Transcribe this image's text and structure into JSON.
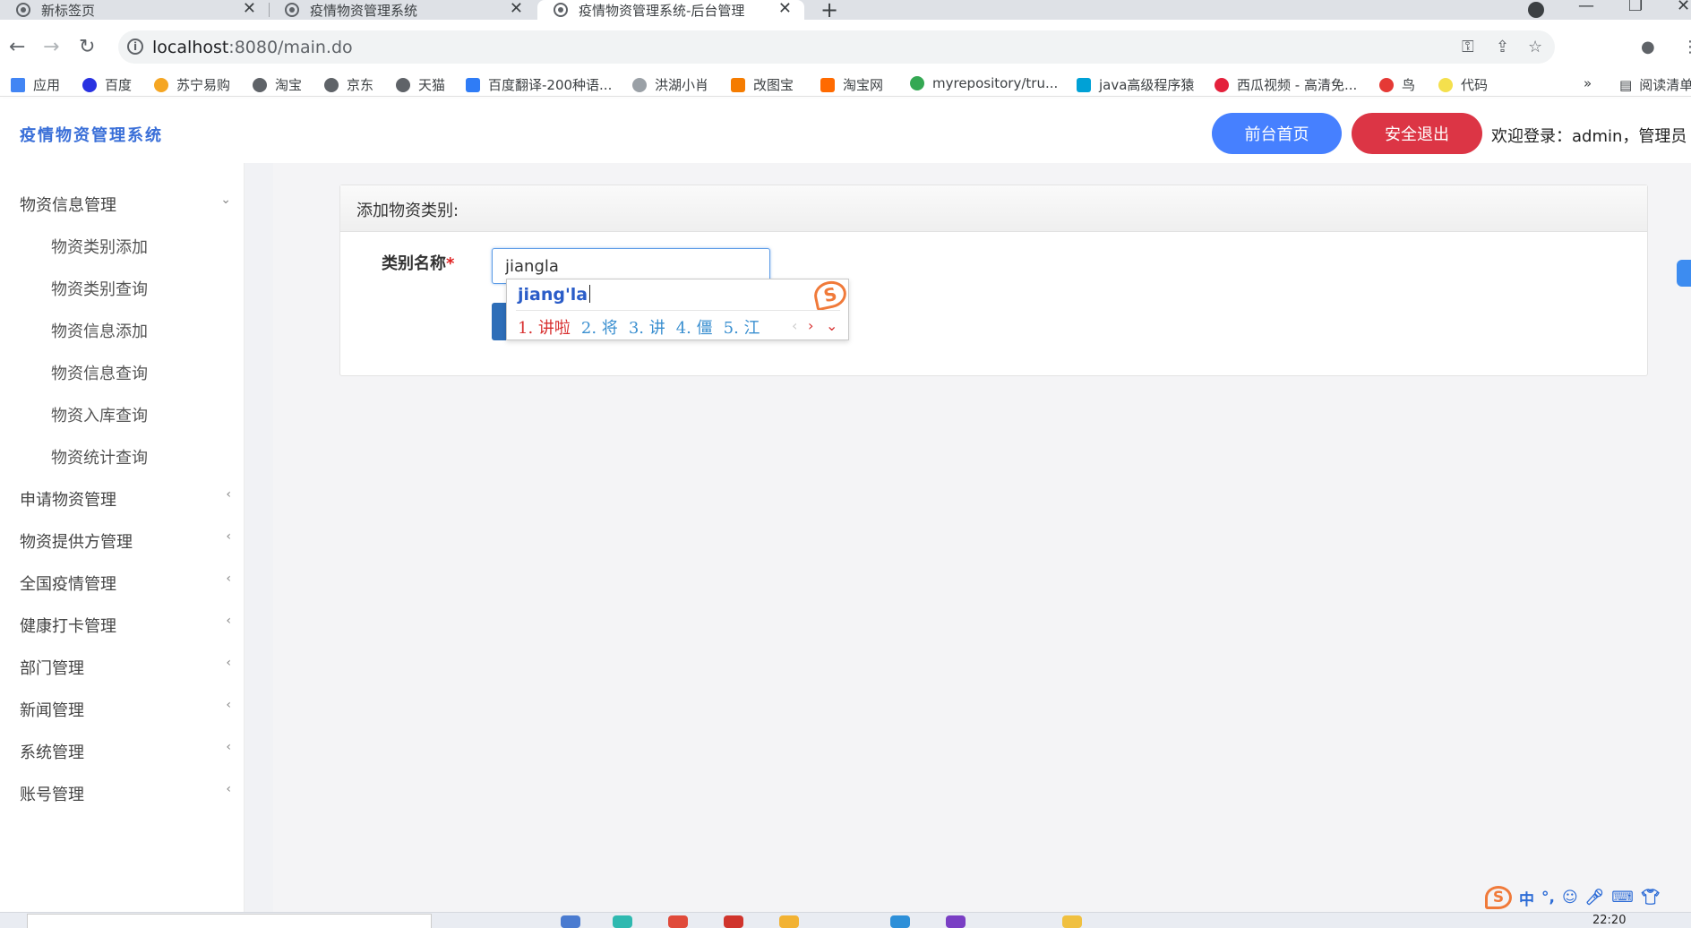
{
  "browser": {
    "tabs": [
      {
        "title": "新标签页",
        "active": false
      },
      {
        "title": "疫情物资管理系统",
        "active": false
      },
      {
        "title": "疫情物资管理系统-后台管理",
        "active": true
      }
    ],
    "url_host": "localhost",
    "url_rest": ":8080/main.do",
    "bookmarks": [
      {
        "label": "应用",
        "color": "#4285f4"
      },
      {
        "label": "百度",
        "color": "#2932e1"
      },
      {
        "label": "苏宁易购",
        "color": "#f5a623"
      },
      {
        "label": "淘宝",
        "color": "#5f6368"
      },
      {
        "label": "京东",
        "color": "#5f6368"
      },
      {
        "label": "天猫",
        "color": "#5f6368"
      },
      {
        "label": "百度翻译-200种语...",
        "color": "#2f7cf6"
      },
      {
        "label": "洪湖小肖",
        "color": "#9aa0a6"
      },
      {
        "label": "改图宝",
        "color": "#f57c00"
      },
      {
        "label": "淘宝网",
        "color": "#ff6a00"
      },
      {
        "label": "myrepository/tru...",
        "color": "#34a853"
      },
      {
        "label": "java高级程序猿",
        "color": "#00a1d6"
      },
      {
        "label": "西瓜视频 - 高清免...",
        "color": "#e4213c"
      },
      {
        "label": "鸟",
        "color": "#e53935"
      },
      {
        "label": "代码",
        "color": "#f4e04d"
      }
    ],
    "bookmarks_overflow": "»",
    "reading_list": "阅读清单"
  },
  "header": {
    "brand": "疫情物资管理系统",
    "home_button": "前台首页",
    "logout_button": "安全退出",
    "welcome": "欢迎登录：admin，管理员"
  },
  "sidebar": {
    "expanded": {
      "label": "物资信息管理",
      "children": [
        "物资类别添加",
        "物资类别查询",
        "物资信息添加",
        "物资信息查询",
        "物资入库查询",
        "物资统计查询"
      ]
    },
    "collapsed": [
      "申请物资管理",
      "物资提供方管理",
      "全国疫情管理",
      "健康打卡管理",
      "部门管理",
      "新闻管理",
      "系统管理",
      "账号管理"
    ]
  },
  "form": {
    "title": "添加物资类别:",
    "label": "类别名称",
    "required_mark": "*",
    "input_value": "jiangla"
  },
  "ime": {
    "composition": "jiang'la",
    "candidates": [
      "1. 讲啦",
      "2. 将",
      "3. 讲",
      "4. 僵",
      "5. 江"
    ]
  },
  "taskbar": {
    "time": "22:20",
    "tray": [
      "中",
      "°,",
      "☺"
    ]
  }
}
